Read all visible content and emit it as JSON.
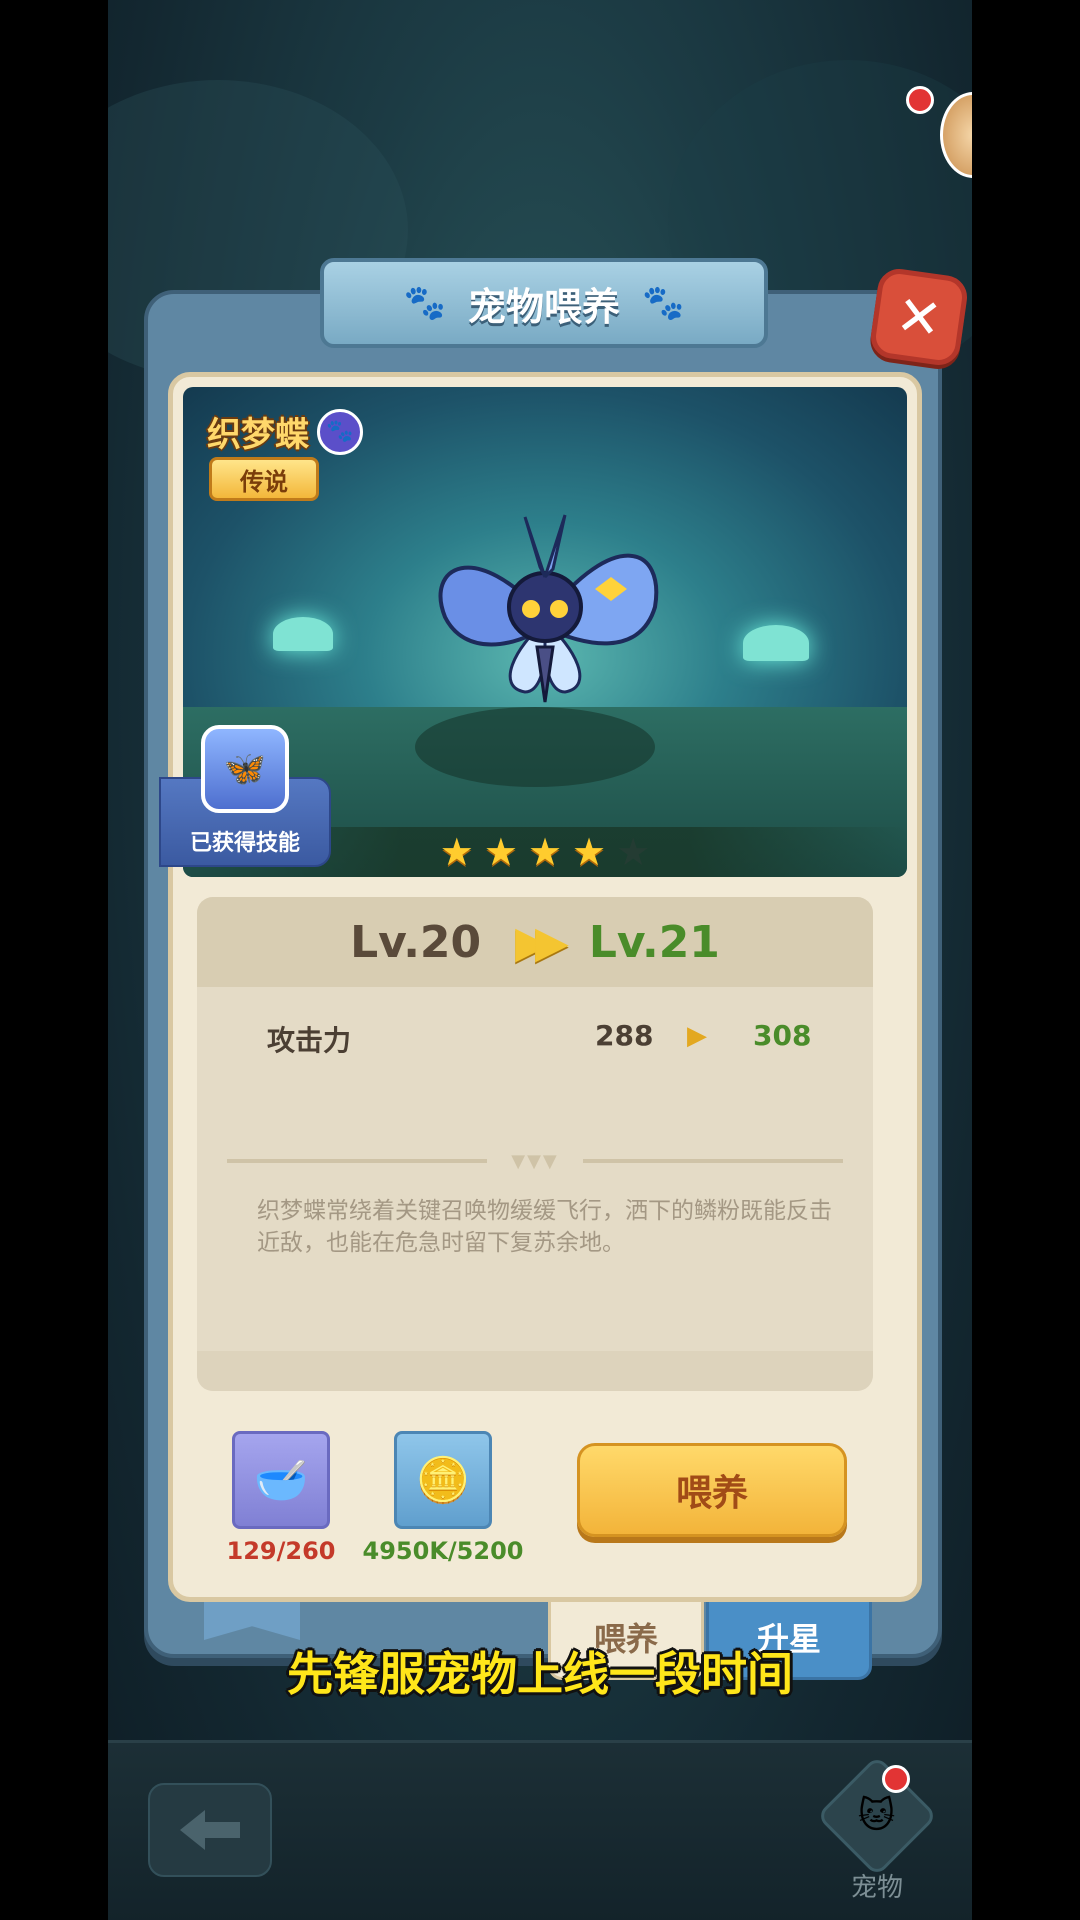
{
  "dialog": {
    "title": "宠物喂养",
    "close_label": "✕"
  },
  "pet": {
    "name": "织梦蝶",
    "rarity": "传说",
    "skill_label": "已获得技能",
    "stars_filled": 4,
    "stars_total": 5
  },
  "level": {
    "current": "Lv.20",
    "next": "Lv.21"
  },
  "stat": {
    "name": "攻击力",
    "current": "288",
    "next": "308"
  },
  "description": "织梦蝶常绕着关键召唤物缓缓飞行，洒下的鳞粉既能反击近敌，也能在危急时留下复苏余地。",
  "resources": {
    "food": "129/260",
    "coins": "4950K/5200"
  },
  "feed_button": "喂养",
  "tabs": {
    "feed": "喂养",
    "upgrade": "升星"
  },
  "subtitle": "先锋服宠物上线一段时间",
  "bottom_nav": {
    "pet_label": "宠物"
  },
  "colors": {
    "accent_gold": "#f3b43a",
    "panel_blue": "#5f87a3",
    "value_green": "#4a8c2a",
    "value_red": "#c43a2a"
  }
}
